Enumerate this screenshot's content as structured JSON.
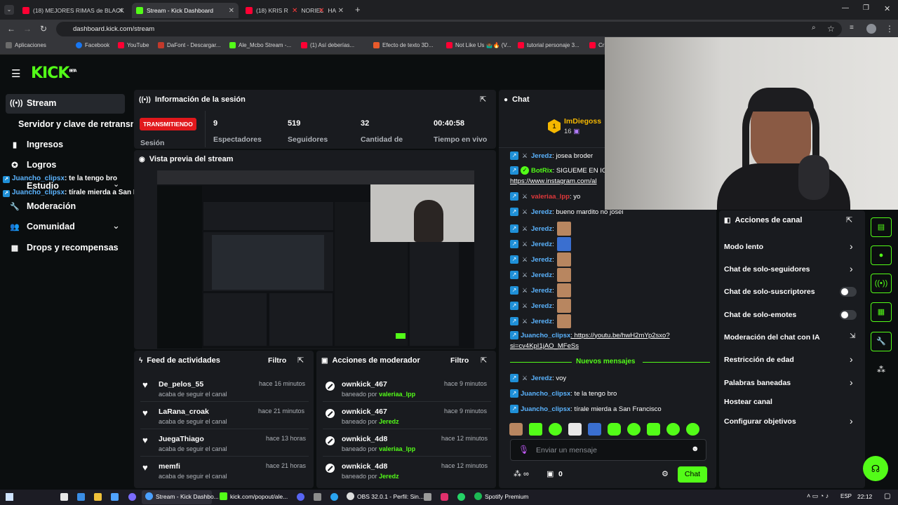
{
  "browser": {
    "tabs": [
      {
        "title": "(18) MEJORES RIMAS de BLACK",
        "active": false
      },
      {
        "title": "Stream - Kick Dashboard",
        "active": true
      },
      {
        "title": "(18) KRIS R",
        "active": false
      },
      {
        "title": "NORIEL",
        "active": false
      },
      {
        "title": "HA",
        "active": false
      }
    ],
    "url": "dashboard.kick.com/stream",
    "bookmarks": [
      "Aplicaciones",
      "Facebook",
      "YouTube",
      "DaFont - Descargar...",
      "Ale_Mcbo Stream -...",
      "(1) Así deberías...",
      "Efecto de texto 3D...",
      "Not Like Us 🤷🏾‍♂️🔥 (V...",
      "tutorial personaje 3...",
      "Cr"
    ]
  },
  "sidebar": {
    "logo": "KICK",
    "logo_sup": "BETA",
    "items": [
      {
        "label": "Stream",
        "icon": "broadcast-icon"
      },
      {
        "label": "Servidor y clave de retransm"
      },
      {
        "label": "Ingresos",
        "icon": "chart-icon"
      },
      {
        "label": "Logros",
        "icon": "medal-icon"
      },
      {
        "label": "Estudio"
      },
      {
        "label": "Moderación",
        "icon": "wrench-icon"
      },
      {
        "label": "Comunidad",
        "icon": "people-icon"
      },
      {
        "label": "Drops y recompensas",
        "icon": "gift-icon"
      }
    ],
    "overlay_chat": [
      {
        "user": "Juancho_clipsx",
        "msg": ": te la tengo bro"
      },
      {
        "user": "Juancho_clipsx",
        "msg": ": tírale mierda a San Francisco"
      }
    ]
  },
  "session": {
    "title": "Información de la sesión",
    "live_badge": "TRANSMITIENDO",
    "session_label": "Sesión",
    "stats": [
      {
        "value": "9",
        "label": "Espectadores"
      },
      {
        "value": "519",
        "label": "Seguidores"
      },
      {
        "value": "32",
        "label": "Cantidad de"
      },
      {
        "value": "00:40:58",
        "label": "Tiempo en vivo"
      }
    ]
  },
  "preview": {
    "title": "Vista previa del stream"
  },
  "activity_feed": {
    "title": "Feed de actividades",
    "filter": "Filtro",
    "items": [
      {
        "name": "De_pelos_55",
        "sub": "acaba de seguir el canal",
        "time": "hace 16 minutos"
      },
      {
        "name": "LaRana_croak",
        "sub": "acaba de seguir el canal",
        "time": "hace 21 minutos"
      },
      {
        "name": "JuegaThiago",
        "sub": "acaba de seguir el canal",
        "time": "hace 13 horas"
      },
      {
        "name": "memfi",
        "sub": "acaba de seguir el canal",
        "time": "hace 21 horas"
      }
    ]
  },
  "mod_actions": {
    "title": "Acciones de moderador",
    "filter": "Filtro",
    "items": [
      {
        "name": "ownkick_467",
        "prefix": "baneado por",
        "by": "valeriaa_lpp",
        "time": "hace 9 minutos"
      },
      {
        "name": "ownkick_467",
        "prefix": "baneado por",
        "by": "Jeredz",
        "time": "hace 9 minutos"
      },
      {
        "name": "ownkick_4d8",
        "prefix": "baneado por",
        "by": "valeriaa_lpp",
        "time": "hace 12 minutos"
      },
      {
        "name": "ownkick_4d8",
        "prefix": "baneado por",
        "by": "Jeredz",
        "time": "hace 12 minutos"
      }
    ]
  },
  "chat": {
    "title": "Chat",
    "pinned_user": "ImDiegoss",
    "pinned_count": "16",
    "pinned_rank": "1",
    "messages": [
      {
        "user": "Jeredz",
        "text": ": josea broder"
      },
      {
        "user": "BotRix",
        "text": ": SIGUEME EN IG"
      },
      {
        "user": "",
        "text": "https://www.instagram.com/al"
      },
      {
        "user": "valeriaa_lpp",
        "text": ": yo"
      },
      {
        "user": "Jeredz",
        "text": ": bueno mardito no josei"
      },
      {
        "user": "Jeredz",
        "text": ":"
      },
      {
        "user": "Jeredz",
        "text": ":"
      },
      {
        "user": "Jeredz",
        "text": ":"
      },
      {
        "user": "Jeredz",
        "text": ":"
      },
      {
        "user": "Jeredz",
        "text": ":"
      },
      {
        "user": "Jeredz",
        "text": ":"
      },
      {
        "user": "Jeredz",
        "text": ":"
      },
      {
        "user": "Juancho_clipsx",
        "text": ": https://youtu.be/hwH2mYp2sxo?"
      },
      {
        "user": "",
        "text": "si=cv4KpI1jAO_MFeSs"
      }
    ],
    "new_messages": "Nuevos mensajes",
    "new": [
      {
        "user": "Jeredz",
        "text": ": voy"
      },
      {
        "user": "Juancho_clipsx",
        "text": ": te la tengo bro"
      },
      {
        "user": "Juancho_clipsx",
        "text": ": tírale mierda a San Francisco"
      }
    ],
    "input_placeholder": "Enviar un mensaje",
    "points": "0",
    "send": "Chat"
  },
  "channel_actions": {
    "title": "Acciones de canal",
    "items": [
      {
        "label": "Modo lento",
        "control": "chevron"
      },
      {
        "label": "Chat de solo-seguidores",
        "control": "chevron"
      },
      {
        "label": "Chat de solo-suscriptores",
        "control": "toggle"
      },
      {
        "label": "Chat de solo-emotes",
        "control": "toggle"
      },
      {
        "label": "Moderación del chat con IA",
        "control": "external"
      },
      {
        "label": "Restricción de edad",
        "control": "chevron"
      },
      {
        "label": "Palabras baneadas",
        "control": "chevron"
      },
      {
        "label": "Hostear canal",
        "control": "none"
      },
      {
        "label": "Configurar objetivos",
        "control": "chevron"
      }
    ]
  },
  "taskbar": {
    "items": [
      "Stream - Kick Dashbo...",
      "kick.com/popout/ale...",
      "OBS 32.0.1 - Perfil: Sin...",
      "Spotify Premium"
    ],
    "lang": "ESP",
    "time": "22:12"
  },
  "colors": {
    "accent": "#53fc18",
    "live": "#e1181c",
    "panel": "#191b1f",
    "bg": "#0b0e0f"
  }
}
